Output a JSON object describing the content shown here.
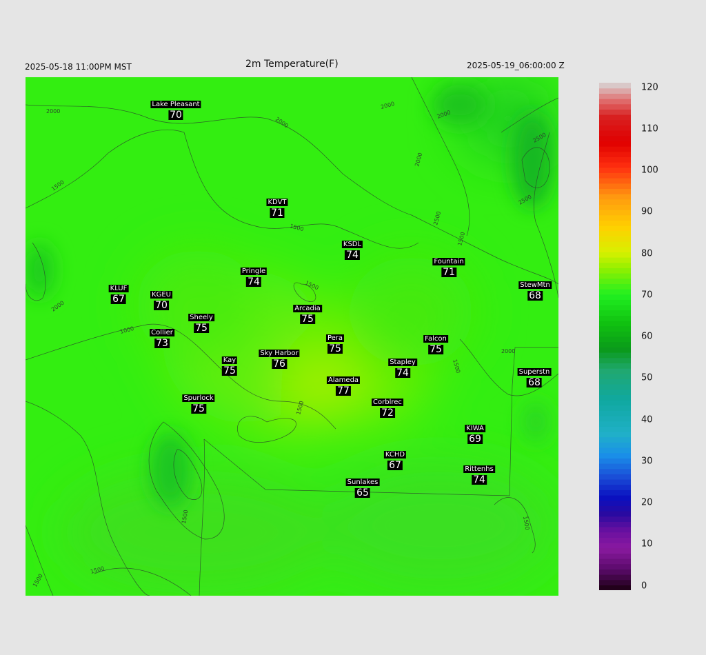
{
  "header": {
    "left": "2025-05-18 11:00PM MST",
    "title": "2m Temperature(F)",
    "right": "2025-05-19_06:00:00 Z"
  },
  "stations": [
    {
      "name": "Lake Pleasant",
      "value": "70"
    },
    {
      "name": "KDVT",
      "value": "71"
    },
    {
      "name": "KSDL",
      "value": "74"
    },
    {
      "name": "Fountain",
      "value": "71"
    },
    {
      "name": "StewMtn",
      "value": "68"
    },
    {
      "name": "Pringle",
      "value": "74"
    },
    {
      "name": "KLUF",
      "value": "67"
    },
    {
      "name": "KGEU",
      "value": "70"
    },
    {
      "name": "Arcadia",
      "value": "75"
    },
    {
      "name": "Sheely",
      "value": "75"
    },
    {
      "name": "Collier",
      "value": "73"
    },
    {
      "name": "Pera",
      "value": "75"
    },
    {
      "name": "Falcon",
      "value": "75"
    },
    {
      "name": "Kay",
      "value": "75"
    },
    {
      "name": "Sky Harbor",
      "value": "76"
    },
    {
      "name": "Stapley",
      "value": "74"
    },
    {
      "name": "Superstn",
      "value": "68"
    },
    {
      "name": "Alameda",
      "value": "77"
    },
    {
      "name": "Spurlock",
      "value": "75"
    },
    {
      "name": "Corblrec",
      "value": "72"
    },
    {
      "name": "KIWA",
      "value": "69"
    },
    {
      "name": "KCHD",
      "value": "67"
    },
    {
      "name": "Rittenhs",
      "value": "74"
    },
    {
      "name": "Sunlakes",
      "value": "65"
    }
  ],
  "contours": [
    {
      "label": "2000"
    },
    {
      "label": "2000"
    },
    {
      "label": "2000"
    },
    {
      "label": "2000"
    },
    {
      "label": "2500"
    },
    {
      "label": "2000"
    },
    {
      "label": "2500"
    },
    {
      "label": "2500"
    },
    {
      "label": "1500"
    },
    {
      "label": "1500"
    },
    {
      "label": "1500"
    },
    {
      "label": "1500"
    },
    {
      "label": "2000"
    },
    {
      "label": "1000"
    },
    {
      "label": "1500"
    },
    {
      "label": "1500"
    },
    {
      "label": "1500"
    },
    {
      "label": "1500"
    },
    {
      "label": "1500"
    },
    {
      "label": "1500"
    },
    {
      "label": "2000"
    }
  ],
  "colorbar": {
    "ticks": [
      "120",
      "110",
      "100",
      "90",
      "80",
      "70",
      "60",
      "50",
      "40",
      "30",
      "20",
      "10",
      "0"
    ],
    "range": [
      0,
      120
    ],
    "stops": [
      {
        "v": 0,
        "c": "#1a0010"
      },
      {
        "v": 5,
        "c": "#5a0a6a"
      },
      {
        "v": 10,
        "c": "#8a1aa0"
      },
      {
        "v": 14,
        "c": "#6a10a0"
      },
      {
        "v": 18,
        "c": "#2a0aa0"
      },
      {
        "v": 22,
        "c": "#0a10c0"
      },
      {
        "v": 27,
        "c": "#1a50d8"
      },
      {
        "v": 32,
        "c": "#1a90e8"
      },
      {
        "v": 37,
        "c": "#20b0c8"
      },
      {
        "v": 45,
        "c": "#10a8a0"
      },
      {
        "v": 52,
        "c": "#20a870"
      },
      {
        "v": 57,
        "c": "#0a9a1a"
      },
      {
        "v": 63,
        "c": "#10c010"
      },
      {
        "v": 70,
        "c": "#20f020"
      },
      {
        "v": 76,
        "c": "#90f000"
      },
      {
        "v": 80,
        "c": "#d8f000"
      },
      {
        "v": 86,
        "c": "#ffd000"
      },
      {
        "v": 93,
        "c": "#ff9a10"
      },
      {
        "v": 100,
        "c": "#ff3010"
      },
      {
        "v": 106,
        "c": "#e00000"
      },
      {
        "v": 112,
        "c": "#d82020"
      },
      {
        "v": 116,
        "c": "#e07070"
      },
      {
        "v": 120,
        "c": "#d8d8d8"
      }
    ]
  }
}
